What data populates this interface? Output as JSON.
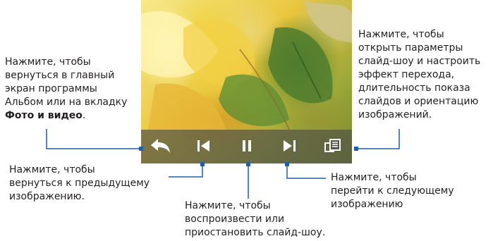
{
  "callouts": {
    "back": {
      "line1": "Нажмите, чтобы",
      "line2": "вернуться в главный",
      "line3": "экран программы",
      "line4": "Альбом или на вкладку",
      "bold": "Фото и видео",
      "tail": "."
    },
    "settings": {
      "line1": "Нажмите, чтобы",
      "line2": "открыть параметры",
      "line3": "слайд-шоу и настроить",
      "line4": "эффект перехода,",
      "line5": "длительность показа",
      "line6": "слайдов и ориентацию",
      "line7": "изображений."
    },
    "previous": {
      "line1": "Нажмите, чтобы",
      "line2": "вернуться к предыдущему",
      "line3": "изображению."
    },
    "play_pause": {
      "line1": "Нажмите, чтобы",
      "line2": "воспроизвести или",
      "line3": "приостановить слайд-шоу."
    },
    "next": {
      "line1": "Нажмите, чтобы",
      "line2": "перейти к следующему",
      "line3": "изображению"
    }
  },
  "toolbar": {
    "buttons": [
      "back-arrow-icon",
      "previous-icon",
      "pause-icon",
      "next-icon",
      "settings-icon"
    ]
  },
  "colors": {
    "callout_line": "#1f5fa8",
    "icon": "#ffffff",
    "toolbar_bg": "#55554699"
  }
}
